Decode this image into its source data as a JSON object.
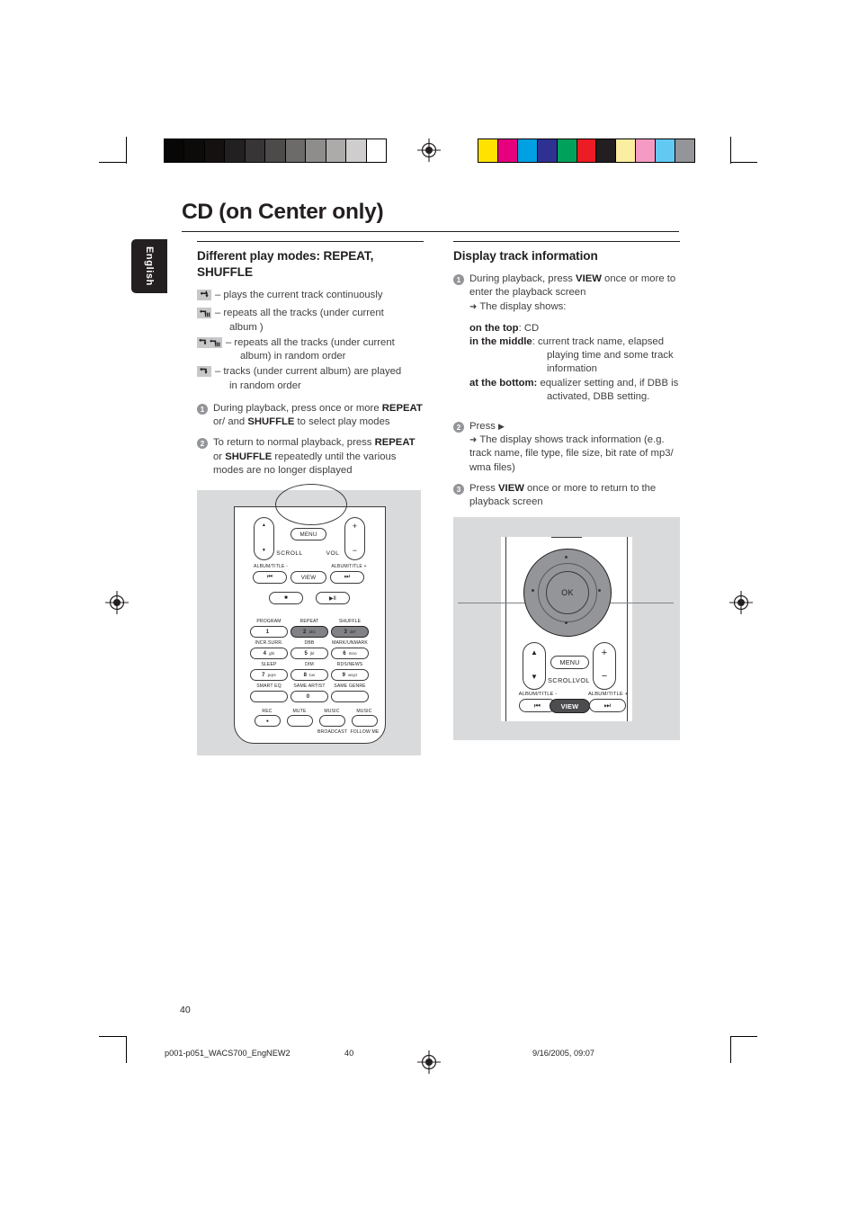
{
  "document": {
    "chapter_title": "CD (on Center only)",
    "language_tab": "English",
    "page_number": "40"
  },
  "calibration": {
    "grayscale": [
      "#070707",
      "#0d0b0a",
      "#141110",
      "#232021",
      "#383536",
      "#4d4a4a",
      "#6d6a6a",
      "#8f8c8c",
      "#adaaaa",
      "#cfcdcd",
      "#ffffff"
    ],
    "color": [
      "#ffe200",
      "#e6007e",
      "#00a0e3",
      "#2e3192",
      "#00a15a",
      "#ed1c24",
      "#231f20",
      "#faeea0",
      "#f59bc3",
      "#62c9f2",
      "#939598"
    ]
  },
  "left_column": {
    "section_title": "Different play modes: REPEAT, SHUFFLE",
    "legend": [
      {
        "icon": "repeat-one-icon",
        "text": "– plays the current track continuously",
        "continuation": ""
      },
      {
        "icon": "repeat-all-icon",
        "text": "– repeats all the tracks (under current",
        "continuation": "album )"
      },
      {
        "icon": "shuffle-repeat-all-icon",
        "text": "– repeats all the tracks (under current",
        "continuation": "album) in random order"
      },
      {
        "icon": "shuffle-icon",
        "text": "– tracks (under current album) are played",
        "continuation": "in random order"
      }
    ],
    "steps": [
      {
        "num": "1",
        "parts": [
          {
            "t": "During playback, press once or more ",
            "b": false
          },
          {
            "t": "REPEAT",
            "b": true
          },
          {
            "t": " or/ and ",
            "b": false
          },
          {
            "t": "SHUFFLE",
            "b": true
          },
          {
            "t": " to select play modes",
            "b": false
          }
        ]
      },
      {
        "num": "2",
        "parts": [
          {
            "t": "To return to normal playback, press ",
            "b": false
          },
          {
            "t": "REPEAT",
            "b": true
          },
          {
            "t": " or ",
            "b": false
          },
          {
            "t": "SHUFFLE",
            "b": true
          },
          {
            "t": " repeatedly until the various modes are no longer displayed",
            "b": false
          }
        ]
      }
    ]
  },
  "right_column": {
    "section_title": "Display track information",
    "step1": {
      "num": "1",
      "line_a": "During playback, press ",
      "line_a_bold": "VIEW",
      "line_a_end": " once or more to enter the playback screen",
      "arrow": "➜",
      "arrow_text": "The display shows:",
      "definitions": [
        {
          "term": "on the top",
          "sep": ": ",
          "desc": "CD",
          "hang": ""
        },
        {
          "term": "in the middle",
          "sep": ": ",
          "desc": "current track name, elapsed",
          "hang": "playing time and some track information"
        },
        {
          "term": "at the bottom:",
          "sep": " ",
          "desc": "equalizer setting and, if DBB is",
          "hang": "activated, DBB setting."
        }
      ]
    },
    "step2": {
      "num": "2",
      "label": "Press",
      "play_glyph": "▶",
      "arrow": "➜",
      "arrow_text": "The display shows track information (e.g. track name, file type, file size, bit rate of mp3/ wma files)"
    },
    "step3": {
      "num": "3",
      "pre": "Press ",
      "bold": "VIEW",
      "post": " once or more to return to the playback screen"
    }
  },
  "figure_left": {
    "name": "remote-control-full",
    "buttons": {
      "menu": "MENU",
      "view": "VIEW",
      "scroll": "SCROLL",
      "vol": "VOL",
      "plus": "+",
      "minus": "−",
      "album_title_minus": "ALBUM/TITLE -",
      "album_title_plus": "ALBUM/TITLE +",
      "prev_glyph": "⏮",
      "next_glyph": "⏭",
      "stop_glyph": "■",
      "play_pause_glyph": "▶Ⅱ",
      "up_glyph": "▲",
      "down_glyph": "▼"
    },
    "keypad": [
      {
        "label": "PROGRAM",
        "key": "1",
        "sub": ""
      },
      {
        "label": "REPEAT",
        "key": "2",
        "sub": "abc",
        "highlight": true
      },
      {
        "label": "SHUFFLE",
        "key": "3",
        "sub": "def",
        "highlight": true
      },
      {
        "label": "INCR.SURR.",
        "key": "4",
        "sub": "ghi"
      },
      {
        "label": "DBB",
        "key": "5",
        "sub": "jkl"
      },
      {
        "label": "MARK/UNMARK",
        "key": "6",
        "sub": "mno"
      },
      {
        "label": "SLEEP",
        "key": "7",
        "sub": "pqrs"
      },
      {
        "label": "DIM",
        "key": "8",
        "sub": "tuv"
      },
      {
        "label": "RDS/NEWS",
        "key": "9",
        "sub": "wxyz"
      },
      {
        "label": "SMART EQ",
        "key": "",
        "sub": ""
      },
      {
        "label": "SAME ARTIST",
        "key": "0",
        "sub": ""
      },
      {
        "label": "SAME GENRE",
        "key": "",
        "sub": ""
      }
    ],
    "bottom_row": [
      {
        "top": "REC",
        "glyph": "●",
        "bottom": ""
      },
      {
        "top": "MUTE",
        "glyph": "",
        "bottom": ""
      },
      {
        "top": "MUSIC",
        "glyph": "",
        "bottom": "BROADCAST"
      },
      {
        "top": "MUSIC",
        "glyph": "",
        "bottom": "FOLLOW ME"
      }
    ]
  },
  "figure_right": {
    "name": "remote-control-detail",
    "ok": "OK",
    "menu": "MENU",
    "view": "VIEW",
    "scroll": "SCROLL",
    "vol": "VOL",
    "plus": "+",
    "minus": "−",
    "album_title_minus": "ALBUM/TITLE -",
    "album_title_plus": "ALBUM/TITLE +",
    "prev_glyph": "⏮",
    "next_glyph": "⏭",
    "up_glyph": "▲",
    "down_glyph": "▼"
  },
  "footer": {
    "filename": "p001-p051_WACS700_EngNEW2",
    "page": "40",
    "timestamp": "9/16/2005, 09:07"
  }
}
